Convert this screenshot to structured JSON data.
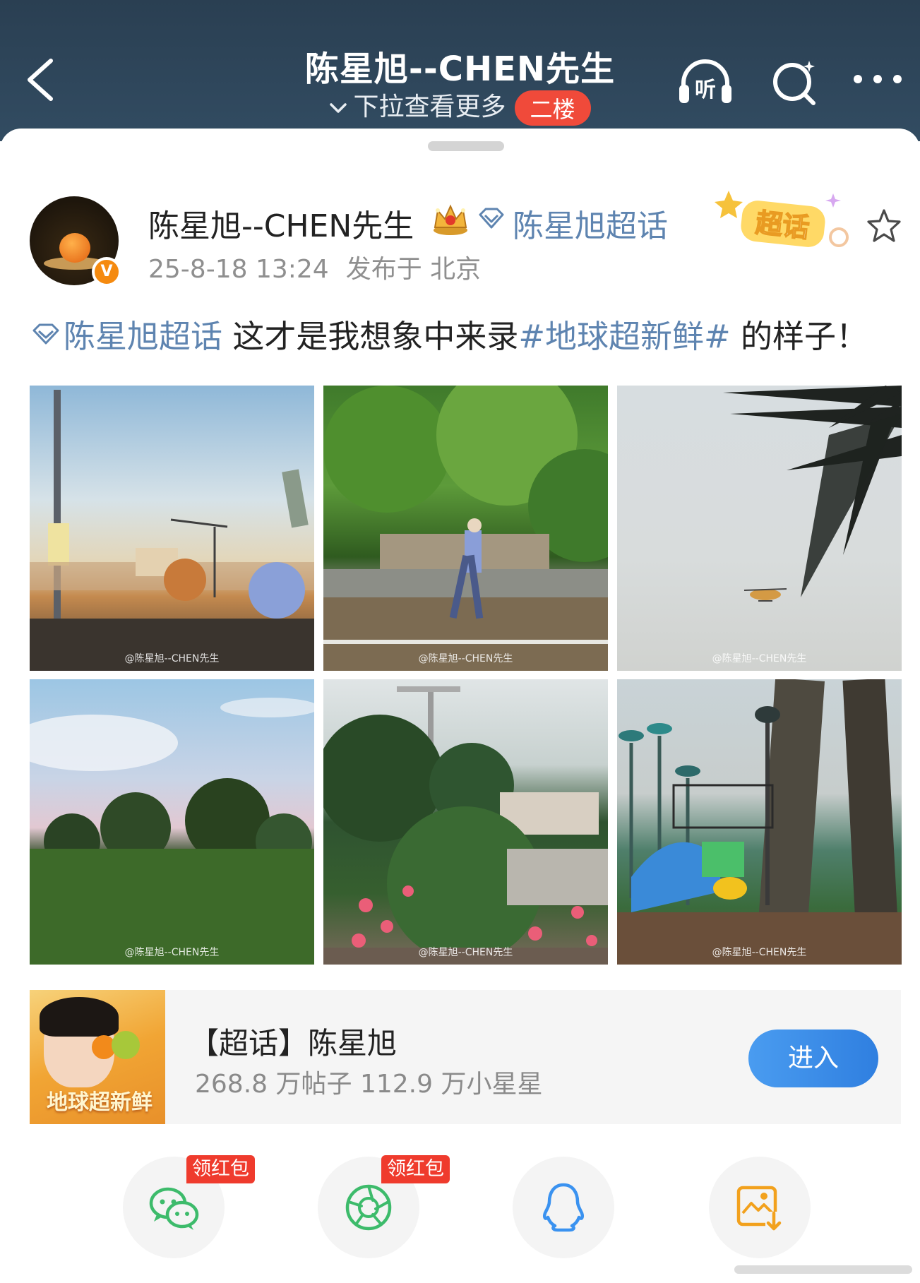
{
  "header": {
    "title": "陈星旭--CHEN先生",
    "subtitle": "下拉查看更多",
    "floor_tag": "二楼",
    "listen_icon_text": "听",
    "icons": [
      "back-icon",
      "headphones-icon",
      "search-icon",
      "more-icon"
    ]
  },
  "author": {
    "name": "陈星旭--CHEN先生",
    "badge_letter": "V",
    "topic": "陈星旭超话",
    "time": "25-8-18 13:24",
    "location": "发布于 北京",
    "chaohua_badge": "超话"
  },
  "post": {
    "topic_link": "陈星旭超话",
    "text_part": " 这才是我想象中来录",
    "hashtag": "#地球超新鲜#",
    "text_end": " 的样子！"
  },
  "photos": [
    {
      "watermark": "@陈星旭--CHEN先生"
    },
    {
      "watermark": "@陈星旭--CHEN先生"
    },
    {
      "watermark": "@陈星旭--CHEN先生"
    },
    {
      "watermark": "@陈星旭--CHEN先生"
    },
    {
      "watermark": "@陈星旭--CHEN先生"
    },
    {
      "watermark": "@陈星旭--CHEN先生"
    }
  ],
  "topic_card": {
    "title": "【超话】陈星旭",
    "stats": "268.8 万帖子 112.9 万小星星",
    "button": "进入",
    "cover_text": "地球超新鲜"
  },
  "share": {
    "red_packet_label": "领红包",
    "items": [
      "wechat-icon",
      "moments-icon",
      "qq-icon",
      "save-image-icon"
    ]
  },
  "colors": {
    "header_bg": "#2f475b",
    "link_blue": "#5e84b0",
    "red_tag": "#f04a3a",
    "enter_btn": "#3a8ae8",
    "wechat_green": "#3dbb6b",
    "qq_blue": "#3a92f0",
    "save_orange": "#f2a11d"
  }
}
